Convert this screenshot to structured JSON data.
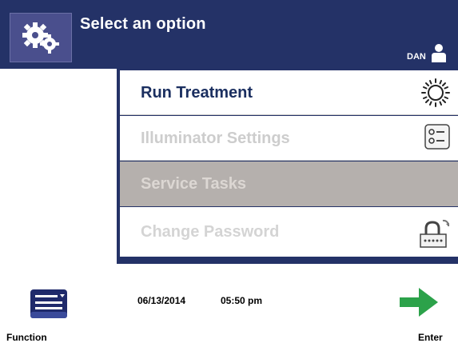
{
  "header": {
    "title": "Select an option",
    "user": "DAN",
    "settings_icon": "gears-icon",
    "user_icon": "user-icon"
  },
  "menu": {
    "items": [
      {
        "label": "Run Treatment",
        "icon": "sun-icon",
        "state": "enabled"
      },
      {
        "label": "Illuminator Settings",
        "icon": "settings-list-icon",
        "state": "disabled"
      },
      {
        "label": "Service Tasks",
        "icon": "",
        "state": "selected"
      },
      {
        "label": "Change Password",
        "icon": "lock-password-icon",
        "state": "disabled"
      }
    ]
  },
  "footer": {
    "function_label": "Function",
    "date": "06/13/2014",
    "time": "05:50 pm",
    "enter_label": "Enter",
    "function_icon": "keyboard-menu-icon",
    "enter_icon": "arrow-right-icon"
  },
  "colors": {
    "header_bg": "#243267",
    "selected_bg": "#b5b0ad",
    "primary_text": "#1b2f60",
    "enter_arrow": "#2ca24a"
  }
}
